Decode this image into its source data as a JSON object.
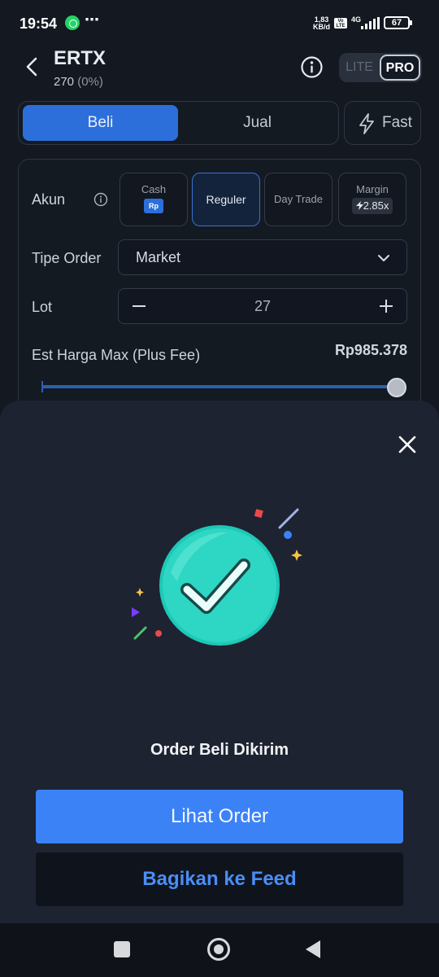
{
  "status_bar": {
    "time": "19:54",
    "net_speed_value": "1,83",
    "net_speed_unit": "KB/d",
    "volte_label": "Vo LTE",
    "network_type": "4G",
    "battery_level": "67",
    "whatsapp_icon": "whatsapp-icon",
    "more_icon": "⋯"
  },
  "header": {
    "ticker": "ERTX",
    "price": "270",
    "change": "(0%)",
    "mode_lite": "LITE",
    "mode_pro": "PRO",
    "selected_mode": "PRO"
  },
  "tabs": {
    "buy": "Beli",
    "sell": "Jual",
    "fast": "Fast",
    "selected": "Beli"
  },
  "form": {
    "account_label": "Akun",
    "account_types": [
      {
        "label": "Cash",
        "badge": "Rp",
        "selected": false
      },
      {
        "label": "Reguler",
        "badge": "",
        "selected": true
      },
      {
        "label": "Day Trade",
        "badge": "",
        "selected": false
      },
      {
        "label": "Margin",
        "badge": "2.85x",
        "selected": false
      }
    ],
    "order_type_label": "Tipe Order",
    "order_type_value": "Market",
    "lot_label": "Lot",
    "lot_value": "27",
    "est_label": "Est Harga Max (Plus Fee)",
    "est_value": "Rp985.378",
    "slider_level_fraction": 1.0
  },
  "sheet": {
    "title": "Order Beli Dikirim",
    "primary_button": "Lihat Order",
    "secondary_button": "Bagikan ke Feed"
  },
  "colors": {
    "accent": "#3b82f6",
    "tab_selected": "#2c6fdb",
    "success": "#2fd1c0",
    "background": "#131821",
    "sheet_bg": "#1d2330"
  }
}
